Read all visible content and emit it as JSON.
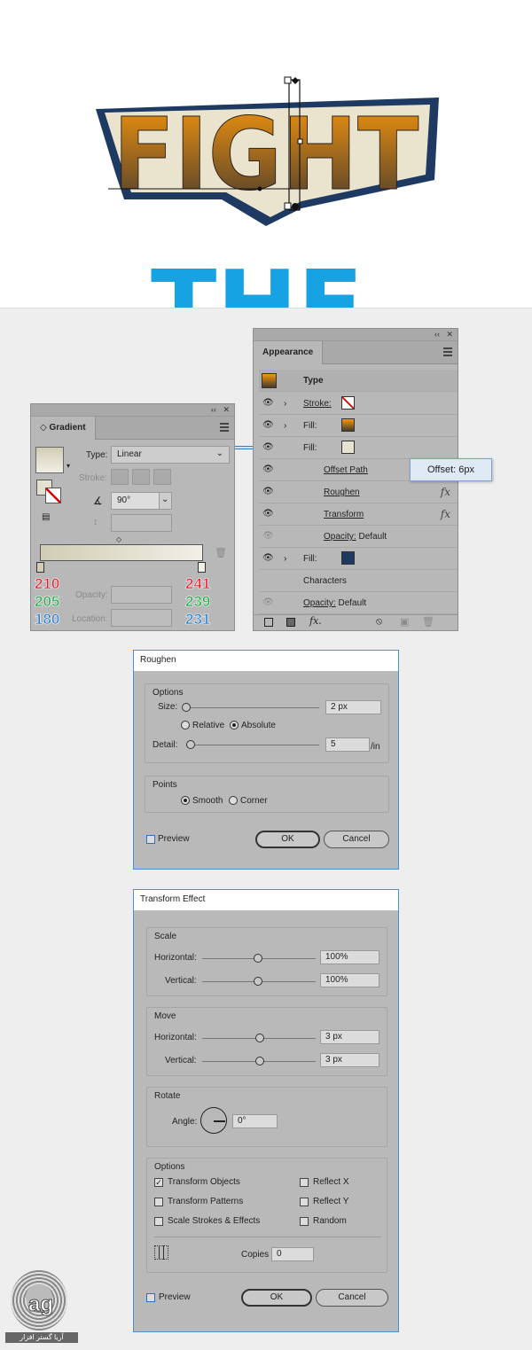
{
  "artboard": {
    "title_word": "FIGHT",
    "subtitle_word": "THE"
  },
  "gradient_panel": {
    "tab": "Gradient",
    "type_label": "Type:",
    "type_value": "Linear",
    "stroke_label": "Stroke:",
    "angle_value": "90°",
    "opacity_label": "Opacity:",
    "location_label": "Location:",
    "left_stop": {
      "r": "210",
      "g": "205",
      "b": "180"
    },
    "right_stop": {
      "r": "241",
      "g": "239",
      "b": "231"
    },
    "colors": {
      "left_stop": "#d2cdb4",
      "right_stop": "#f1efe7"
    }
  },
  "appearance_panel": {
    "tab": "Appearance",
    "header": "Type",
    "rows": [
      {
        "label": "Stroke:"
      },
      {
        "label": "Fill:"
      },
      {
        "label": "Fill:"
      },
      {
        "label": "Offset Path"
      },
      {
        "label": "Roughen"
      },
      {
        "label": "Transform"
      },
      {
        "label": "Opacity:",
        "value": "Default"
      },
      {
        "label": "Fill:"
      },
      {
        "label": "Characters"
      },
      {
        "label": "Opacity:",
        "value": "Default"
      }
    ],
    "tooltip": "Offset: 6px",
    "colors": {
      "fill_dark_blue": "#1e3a63"
    }
  },
  "roughen": {
    "title": "Roughen",
    "options_title": "Options",
    "size_label": "Size:",
    "size_value": "2 px",
    "relative": "Relative",
    "absolute": "Absolute",
    "detail_label": "Detail:",
    "detail_value": "5",
    "detail_unit": "/in",
    "points_title": "Points",
    "smooth": "Smooth",
    "corner": "Corner",
    "preview": "Preview",
    "ok": "OK",
    "cancel": "Cancel"
  },
  "transform": {
    "title": "Transform Effect",
    "scale_title": "Scale",
    "horizontal_label": "Horizontal:",
    "vertical_label": "Vertical:",
    "scale_h": "100%",
    "scale_v": "100%",
    "move_title": "Move",
    "move_h": "3 px",
    "move_v": "3 px",
    "rotate_title": "Rotate",
    "angle_label": "Angle:",
    "angle_value": "0°",
    "options_title": "Options",
    "transform_objects": "Transform Objects",
    "transform_patterns": "Transform Patterns",
    "scale_strokes": "Scale Strokes & Effects",
    "reflect_x": "Reflect X",
    "reflect_y": "Reflect Y",
    "random": "Random",
    "copies_label": "Copies",
    "copies_value": "0",
    "preview": "Preview",
    "ok": "OK",
    "cancel": "Cancel"
  },
  "watermark": {
    "text": "آریا گستر افزار"
  }
}
